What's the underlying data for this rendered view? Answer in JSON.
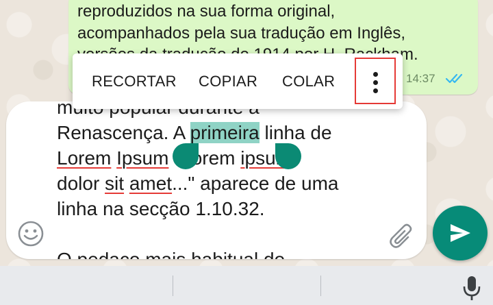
{
  "message": {
    "lines": [
      "reproduzidos na sua forma original,",
      "acompanhados pela sua tradução em Inglês,",
      "versões da tradução de 1914 por H. Rackham."
    ],
    "time": "14:37",
    "status_icon": "double-check-icon",
    "colors": {
      "bubble": "#dcf8c6",
      "ticks": "#34b7f1"
    }
  },
  "selection_toolbar": {
    "cut_label": "RECORTAR",
    "copy_label": "COPIAR",
    "paste_label": "COLAR",
    "more_icon": "more-vert-icon",
    "highlight_color": "#e53935"
  },
  "input": {
    "line1": "muito popular durante a",
    "line2_before": "Renascença. A ",
    "line2_selected": "primeira",
    "line2_after": " linha de",
    "line3_w1": "Lorem",
    "line3_w2": "Ipsum",
    "line3_mid": " \"Lorem ",
    "line3_w3": "ipsum",
    "line4_pre": "dolor ",
    "line4_w1": "sit",
    "line4_mid": " ",
    "line4_w2": "amet",
    "line4_post": "...\" aparece de uma",
    "line5": "linha na secção 1.10.32.",
    "line6": "O pedaço mais habitual do",
    "selection_color": "#8fd3c5",
    "handle_color": "#0b8a74",
    "emoji_icon": "emoji-smile-icon",
    "attach_icon": "paperclip-icon"
  },
  "send": {
    "icon": "send-icon",
    "color": "#078b78"
  },
  "keyboard": {
    "mic_icon": "microphone-icon"
  }
}
